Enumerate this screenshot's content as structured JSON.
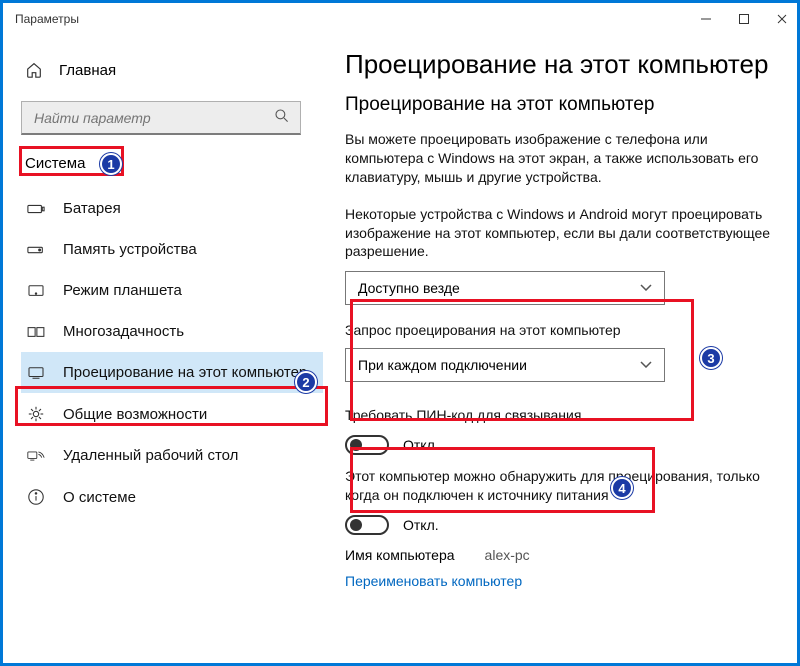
{
  "window": {
    "title": "Параметры"
  },
  "sidebar": {
    "home_label": "Главная",
    "search_placeholder": "Найти параметр",
    "category_label": "Система",
    "items": [
      {
        "label": "Батарея"
      },
      {
        "label": "Память устройства"
      },
      {
        "label": "Режим планшета"
      },
      {
        "label": "Многозадачность"
      },
      {
        "label": "Проецирование на этот компьютер"
      },
      {
        "label": "Общие возможности"
      },
      {
        "label": "Удаленный рабочий стол"
      },
      {
        "label": "О системе"
      }
    ]
  },
  "main": {
    "h1": "Проецирование на этот компьютер",
    "h2": "Проецирование на этот компьютер",
    "p1": "Вы можете проецировать изображение с телефона или компьютера с Windows на этот экран, а также использовать его клавиатуру, мышь и другие устройства.",
    "p2": "Некоторые устройства с Windows и Android могут проецировать изображение на этот компьютер, если вы дали соответствующее разрешение.",
    "select1_value": "Доступно везде",
    "select2_label": "Запрос проецирования на этот компьютер",
    "select2_value": "При каждом подключении",
    "pin_label": "Требовать ПИН-код для связывания",
    "toggle_off": "Откл.",
    "power_text": "Этот компьютер можно обнаружить для проецирования, только когда он подключен к источнику питания",
    "pc_name_label": "Имя компьютера",
    "pc_name_value": "alex-pc",
    "rename_link": "Переименовать компьютер"
  },
  "badges": {
    "b1": "1",
    "b2": "2",
    "b3": "3",
    "b4": "4"
  }
}
